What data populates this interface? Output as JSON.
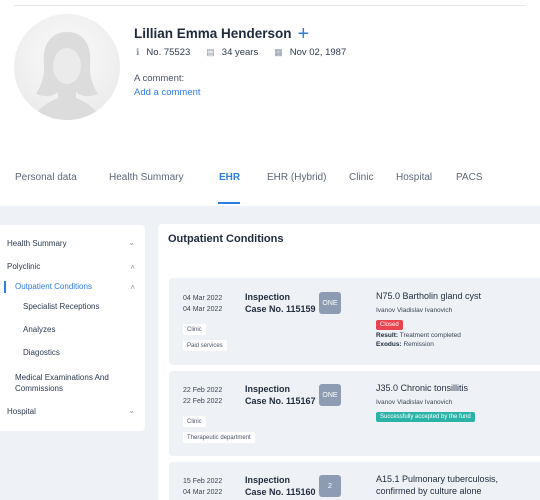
{
  "patient": {
    "name": "Lillian Emma Henderson",
    "number": "No. 75523",
    "age": "34 years",
    "birthdate": "Nov 02, 1987",
    "comment_label": "A comment:",
    "add_comment": "Add a comment"
  },
  "tabs": [
    "Personal data",
    "Health Summary",
    "EHR",
    "EHR (Hybrid)",
    "Clinic",
    "Hospital",
    "PACS"
  ],
  "active_tab": "EHR",
  "sidebar": {
    "health_summary": "Health Summary",
    "polyclinic": "Polyclinic",
    "outpatient_conditions": "Outpatient Conditions",
    "specialist_receptions": "Specialist Receptions",
    "analyzes": "Analyzes",
    "diagostics": "Diagostics",
    "medical_exams_line1": "Medical Examinations And",
    "medical_exams_line2": "Commissions",
    "hospital": "Hospital"
  },
  "main": {
    "title": "Outpatient Conditions"
  },
  "records": [
    {
      "date1": "04 Mar 2022",
      "date2": "04 Mar 2022",
      "type": "Inspection",
      "case": "Case No. 115159",
      "badge": "ONE",
      "chip1": "Clinic",
      "chip2": "Paid services",
      "diagnosis": "N75.0 Bartholin gland cyst",
      "doctor": "Ivanov Vladislav Ivanovich",
      "status": "Closed",
      "status_color": "#e8434f",
      "result_label": "Result:",
      "result_value": "Treatment completed",
      "exodus_label": "Exodus:",
      "exodus_value": "Remission"
    },
    {
      "date1": "22 Feb 2022",
      "date2": "22 Feb 2022",
      "type": "Inspection",
      "case": "Case No. 115167",
      "badge": "ONE",
      "chip1": "Clinic",
      "chip2": "Therapeutic department",
      "diagnosis": "J35.0 Chronic tonsillitis",
      "doctor": "Ivanov Vladislav Ivanovich",
      "status": "Successfully accepted by the fund",
      "status_color": "#2bb3a8"
    },
    {
      "date1": "15 Feb 2022",
      "date2": "04 Mar 2022",
      "type": "Inspection",
      "case": "Case No. 115160",
      "badge": "2",
      "diagnosis_line1": "A15.1 Pulmonary tuberculosis,",
      "diagnosis_line2": "confirmed by culture alone"
    }
  ],
  "colors": {
    "accent": "#2f7de1",
    "closed": "#e8434f",
    "accepted": "#2bb3a8",
    "badge": "#8d9bb3"
  }
}
